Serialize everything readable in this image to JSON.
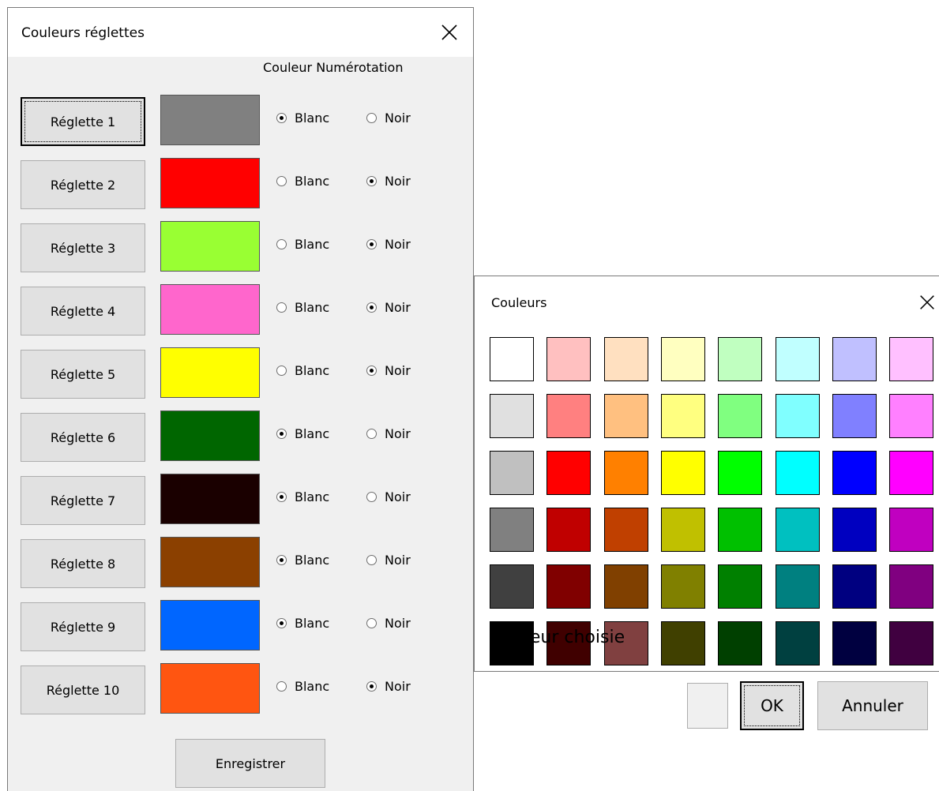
{
  "main_dialog": {
    "title": "Couleurs réglettes",
    "numbering_header": "Couleur Numérotation",
    "save_label": "Enregistrer",
    "white_label": "Blanc",
    "black_label": "Noir",
    "rulers": [
      {
        "label": "Réglette 1",
        "color": "#808080",
        "numbering": "Blanc"
      },
      {
        "label": "Réglette 2",
        "color": "#ff0000",
        "numbering": "Noir"
      },
      {
        "label": "Réglette 3",
        "color": "#99ff33",
        "numbering": "Noir"
      },
      {
        "label": "Réglette 4",
        "color": "#ff66cc",
        "numbering": "Noir"
      },
      {
        "label": "Réglette 5",
        "color": "#ffff00",
        "numbering": "Noir"
      },
      {
        "label": "Réglette 6",
        "color": "#006600",
        "numbering": "Blanc"
      },
      {
        "label": "Réglette 7",
        "color": "#1a0000",
        "numbering": "Blanc"
      },
      {
        "label": "Réglette 8",
        "color": "#8b4000",
        "numbering": "Blanc"
      },
      {
        "label": "Réglette 9",
        "color": "#0066ff",
        "numbering": "Blanc"
      },
      {
        "label": "Réglette 10",
        "color": "#ff5511",
        "numbering": "Noir"
      }
    ],
    "focused_ruler": 0
  },
  "color_dialog": {
    "title": "Couleurs",
    "chosen_label": "Couleur choisie",
    "chosen_color": "#f0f0f0",
    "ok_label": "OK",
    "cancel_label": "Annuler",
    "palette": [
      [
        "#ffffff",
        "#ffc0c0",
        "#ffe0c0",
        "#ffffc0",
        "#c0ffc0",
        "#c0ffff",
        "#c0c0ff",
        "#ffc0ff"
      ],
      [
        "#e0e0e0",
        "#ff8080",
        "#ffc080",
        "#ffff80",
        "#80ff80",
        "#80ffff",
        "#8080ff",
        "#ff80ff"
      ],
      [
        "#c0c0c0",
        "#ff0000",
        "#ff8000",
        "#ffff00",
        "#00ff00",
        "#00ffff",
        "#0000ff",
        "#ff00ff"
      ],
      [
        "#808080",
        "#c00000",
        "#c04000",
        "#c0c000",
        "#00c000",
        "#00c0c0",
        "#0000c0",
        "#c000c0"
      ],
      [
        "#404040",
        "#800000",
        "#804000",
        "#808000",
        "#008000",
        "#008080",
        "#000080",
        "#800080"
      ],
      [
        "#000000",
        "#400000",
        "#804040",
        "#404000",
        "#004000",
        "#004040",
        "#000040",
        "#400040"
      ]
    ]
  }
}
